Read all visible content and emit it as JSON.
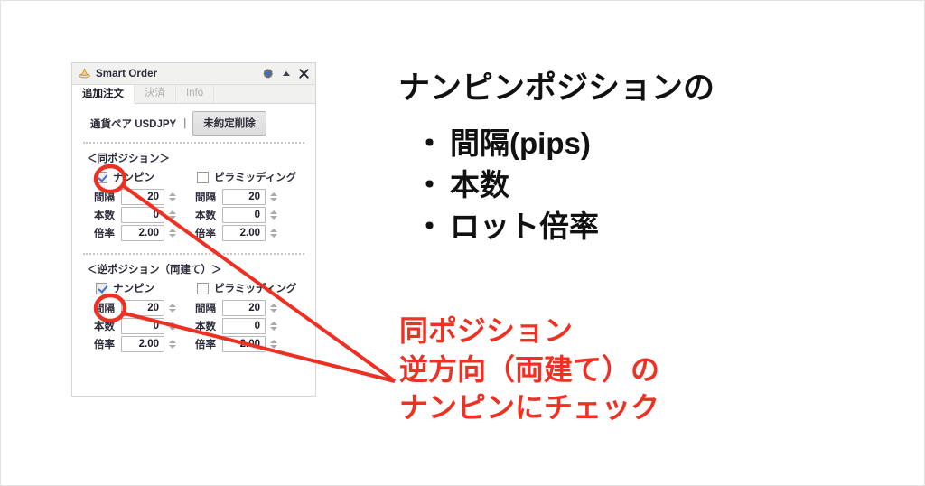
{
  "window": {
    "title": "Smart Order",
    "icon": "app-logo-icon",
    "controls": [
      {
        "name": "settings-gear-icon",
        "glyph": "gear"
      },
      {
        "name": "collapse-up-icon",
        "glyph": "triangle-up"
      },
      {
        "name": "close-icon",
        "glyph": "x"
      }
    ]
  },
  "tabs": [
    {
      "label": "追加注文",
      "active": true
    },
    {
      "label": "決済",
      "active": false
    },
    {
      "label": "Info",
      "active": false
    }
  ],
  "pair_row": {
    "label": "通貨ペア  USDJPY",
    "separator": "|",
    "cancel_button": "未約定削除"
  },
  "sections": [
    {
      "title": "＜同ポジション＞",
      "columns": [
        {
          "checkbox_label": "ナンピン",
          "checked": true,
          "highlighted": true,
          "fields": [
            {
              "label": "間隔",
              "value": "20"
            },
            {
              "label": "本数",
              "value": "0"
            },
            {
              "label": "倍率",
              "value": "2.00"
            }
          ]
        },
        {
          "checkbox_label": "ピラミッディング",
          "checked": false,
          "highlighted": false,
          "fields": [
            {
              "label": "間隔",
              "value": "20"
            },
            {
              "label": "本数",
              "value": "0"
            },
            {
              "label": "倍率",
              "value": "2.00"
            }
          ]
        }
      ]
    },
    {
      "title": "＜逆ポジション（両建て）＞",
      "columns": [
        {
          "checkbox_label": "ナンピン",
          "checked": true,
          "highlighted": true,
          "fields": [
            {
              "label": "間隔",
              "value": "20"
            },
            {
              "label": "本数",
              "value": "0"
            },
            {
              "label": "倍率",
              "value": "2.00"
            }
          ]
        },
        {
          "checkbox_label": "ピラミッディング",
          "checked": false,
          "highlighted": false,
          "fields": [
            {
              "label": "間隔",
              "value": "20"
            },
            {
              "label": "本数",
              "value": "0"
            },
            {
              "label": "倍率",
              "value": "2.00"
            }
          ]
        }
      ]
    }
  ],
  "annotations": {
    "headline": "ナンピンポジションの",
    "bullets": [
      {
        "marker": "・",
        "text": "間隔(pips)"
      },
      {
        "marker": "・",
        "text": "本数"
      },
      {
        "marker": "・",
        "text": "ロット倍率"
      }
    ],
    "callout": [
      "同ポジション",
      "逆方向（両建て）の",
      "ナンピンにチェック"
    ],
    "accent_color": "#ef3124"
  }
}
